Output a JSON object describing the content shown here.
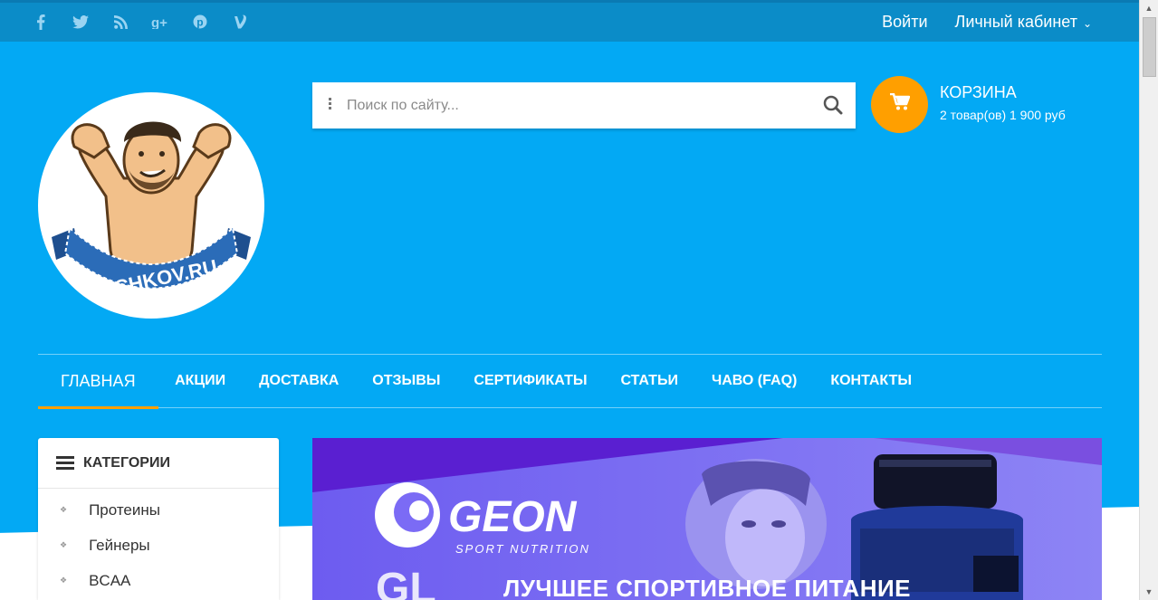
{
  "topbar": {
    "social": [
      {
        "icon": "facebook-icon",
        "glyph": "f"
      },
      {
        "icon": "twitter-icon",
        "glyph": "🐦"
      },
      {
        "icon": "rss-icon",
        "glyph": "◝"
      },
      {
        "icon": "google-plus-icon",
        "glyph": "g+"
      },
      {
        "icon": "pinterest-icon",
        "glyph": "℗"
      },
      {
        "icon": "vine-icon",
        "glyph": "v"
      }
    ],
    "login": "Войти",
    "account": "Личный кабинет"
  },
  "logo": {
    "text": "KACHKOV.RU"
  },
  "search": {
    "placeholder": "Поиск по сайту..."
  },
  "cart": {
    "title": "КОРЗИНА",
    "info": "2 товар(ов) 1 900 руб"
  },
  "nav": {
    "items": [
      "ГЛАВНАЯ",
      "АКЦИИ",
      "ДОСТАВКА",
      "ОТЗЫВЫ",
      "СЕРТИФИКАТЫ",
      "СТАТЬИ",
      "ЧАВО (FAQ)",
      "КОНТАКТЫ"
    ]
  },
  "categories": {
    "title": "КАТЕГОРИИ",
    "items": [
      "Протеины",
      "Гейнеры",
      "BCAA"
    ]
  },
  "banner": {
    "brand": "GEON",
    "brand_sub": "SPORT NUTRITION",
    "caption": "ЛУЧШЕЕ СПОРТИВНОЕ ПИТАНИЕ"
  },
  "colors": {
    "header_bg": "#03a9f4",
    "topbar_bg": "#0b8cc8",
    "accent": "#ff9f00",
    "banner_purple": "#7b6bf5"
  }
}
